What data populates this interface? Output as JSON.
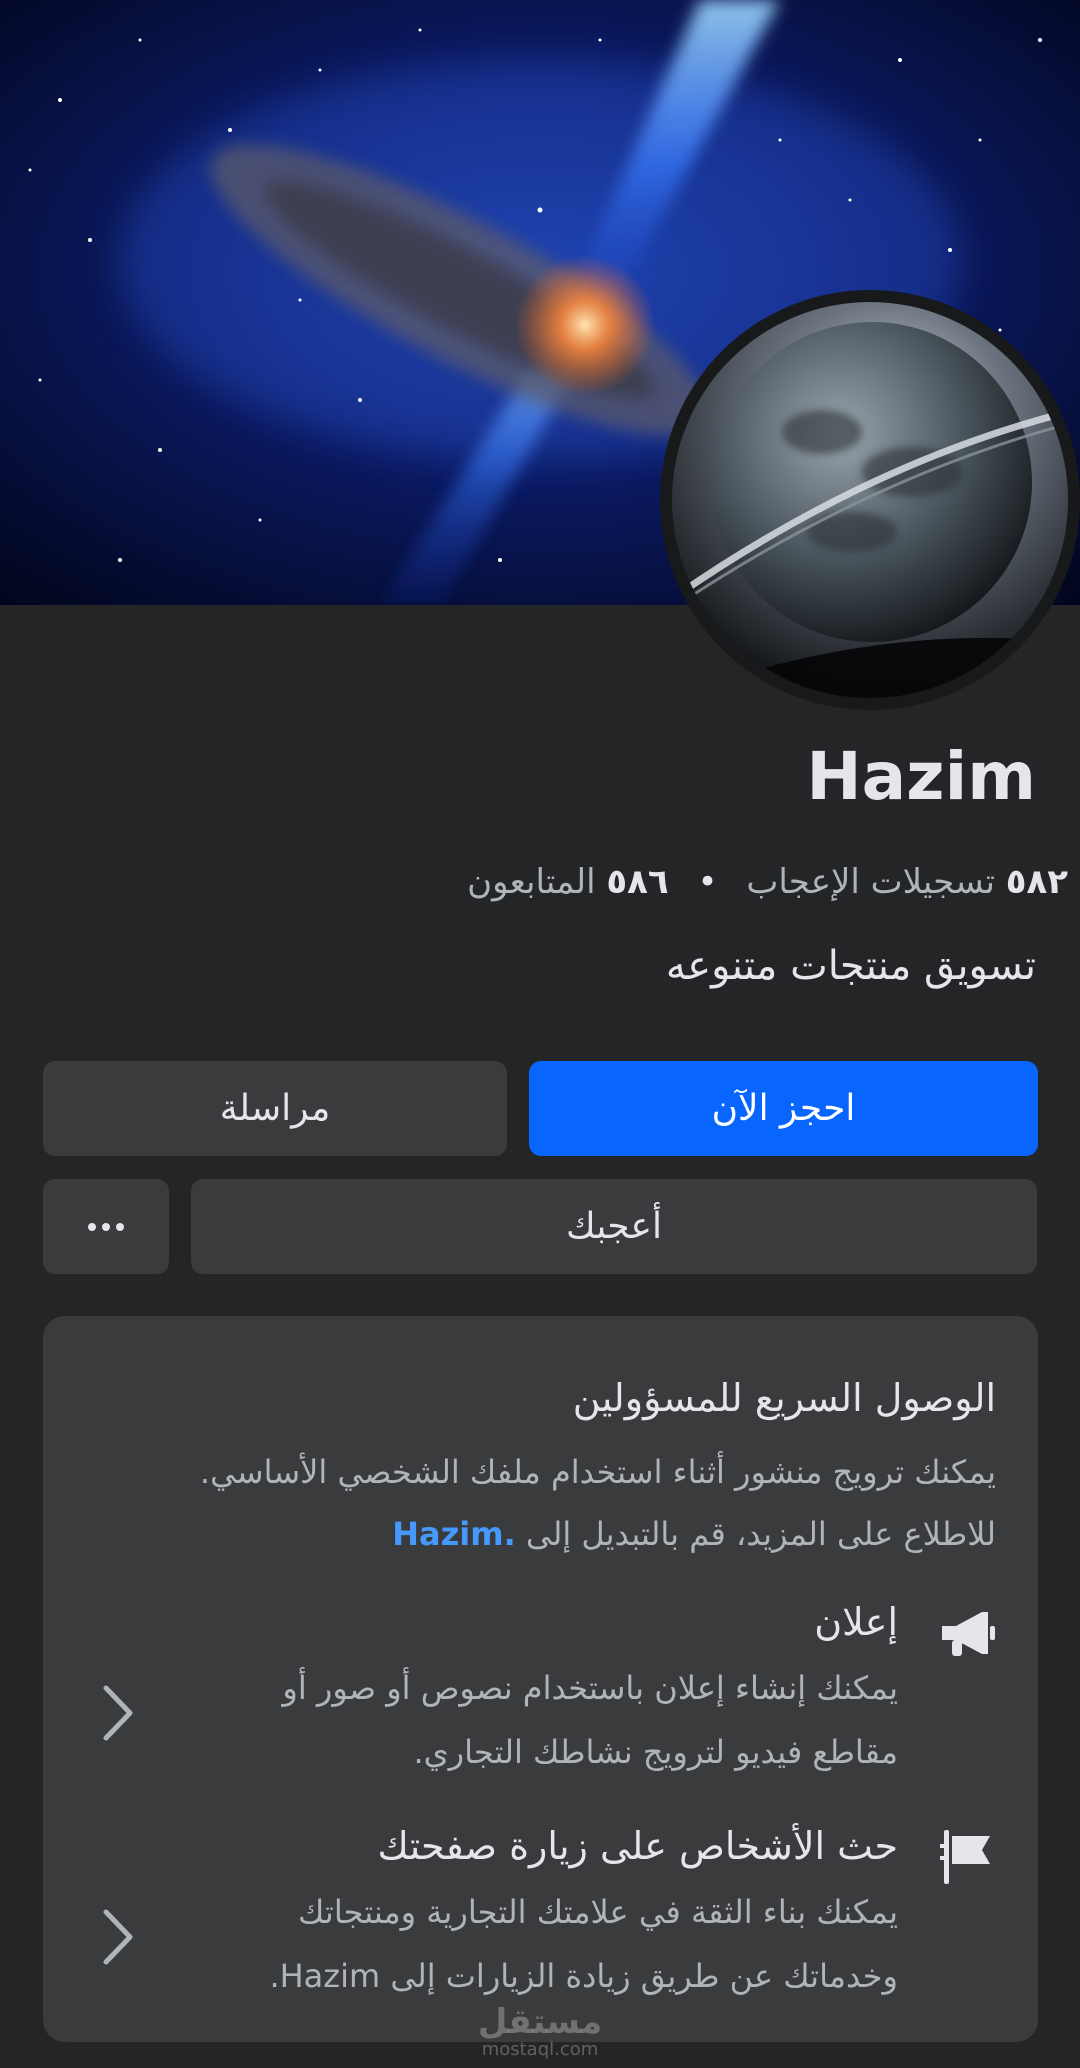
{
  "page": {
    "title": "Hazim",
    "likes_count": "٥٨٢",
    "likes_label": "تسجيلات الإعجاب",
    "separator": "•",
    "followers_count": "٥٨٦",
    "followers_label": "المتابعون",
    "category": "تسويق منتجات متنوعه"
  },
  "actions": {
    "book_now": "احجز الآن",
    "message": "مراسلة",
    "liked": "أعجبك",
    "more_icon": "more-dots-icon"
  },
  "admin_card": {
    "title": "الوصول السريع للمسؤولين",
    "body_line1": "يمكنك ترويج منشور أثناء استخدام ملفك الشخصي الأساسي.",
    "body_line2_prefix": "للاطلاع على المزيد، قم بالتبديل إلى",
    "body_link": "Hazim.",
    "options": [
      {
        "icon": "megaphone-icon",
        "title": "إعلان",
        "desc_line1": "يمكنك إنشاء إعلان باستخدام نصوص أو صور أو",
        "desc_line2": "مقاطع فيديو لترويج نشاطك التجاري."
      },
      {
        "icon": "flag-icon",
        "title": "حث الأشخاص على زيارة صفحتك",
        "desc_line1": "يمكنك بناء الثقة في علامتك التجارية ومنتجاتك",
        "desc_line2": "وخدماتك عن طريق زيادة الزيارات إلى Hazim."
      }
    ]
  },
  "watermark": {
    "arabic": "مستقل",
    "latin": "mostaql.com"
  },
  "colors": {
    "background": "#242526",
    "card": "#3a3b3c",
    "primary_button": "#0866ff",
    "link": "#4599ff",
    "text_primary": "#e4e6eb",
    "text_secondary": "#b0b3b8"
  }
}
